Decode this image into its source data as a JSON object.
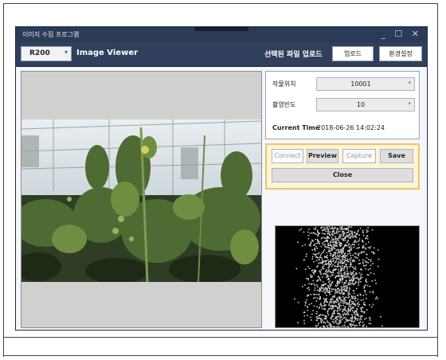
{
  "window": {
    "title": "이미지 수집 프로그램",
    "controls": "_ ☐ ✕"
  },
  "toolbar": {
    "model_value": "R200",
    "app_title": "Image Viewer",
    "upload_label": "선택된 파일 업로드",
    "upload_button": "업로드",
    "settings_button": "환경설정"
  },
  "info": {
    "crop_position_label": "작물위치",
    "crop_position_value": "10001",
    "interval_label": "촬영빈도",
    "interval_value": "10",
    "current_time_label": "Current Time",
    "current_time_value": "2018-06-26 14:02:24"
  },
  "controls": {
    "connect": "Connect",
    "preview": "Preview",
    "capture": "Capture",
    "save": "Save",
    "close": "Close"
  },
  "colors": {
    "title_bar": "#2b3a55",
    "toolbar": "#2f3f5c",
    "control_panel_border": "#e8c76a",
    "control_panel_bg": "#fdf4d6"
  }
}
